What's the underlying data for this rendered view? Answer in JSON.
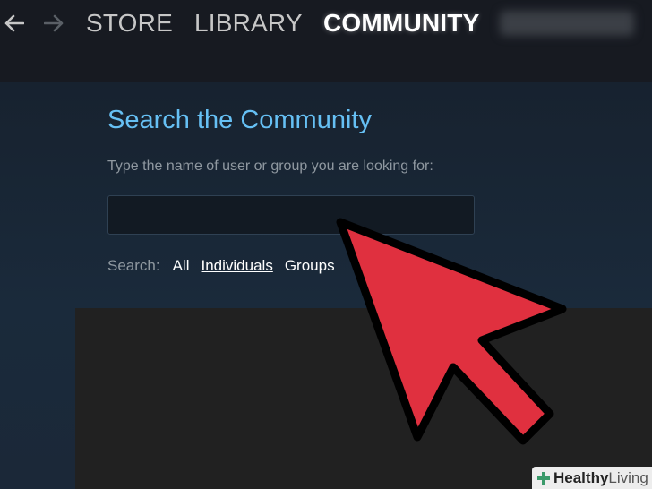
{
  "nav": {
    "back_icon": "arrow-left-icon",
    "forward_icon": "arrow-right-icon",
    "menu": {
      "store": "STORE",
      "library": "LIBRARY",
      "community": "COMMUNITY"
    }
  },
  "search": {
    "title": "Search the Community",
    "instructions": "Type the name of user or group you are looking for:",
    "input_value": "",
    "filter_label": "Search:",
    "filters": [
      "All",
      "Individuals",
      "Groups"
    ],
    "active_filter": "Individuals"
  },
  "overlay": {
    "pointer_icon": "red-pointer-arrow-icon"
  },
  "watermark": {
    "bold": "Healthy",
    "light": "Living"
  },
  "colors": {
    "accent": "#66c0f4",
    "topbar": "#171a21",
    "background": "#1b2838",
    "arrow": "#e0303f"
  }
}
